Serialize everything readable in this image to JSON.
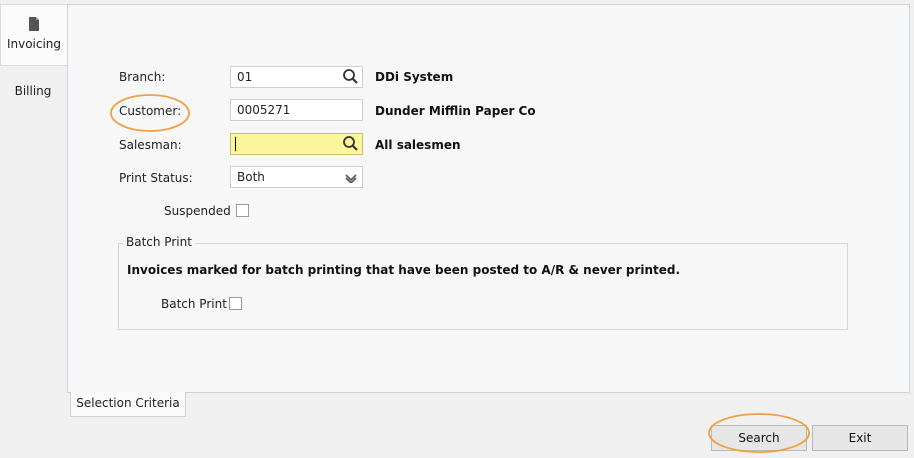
{
  "sidebar": {
    "tabs": [
      {
        "label": "Invoicing",
        "icon": "document-icon",
        "active": true
      },
      {
        "label": "Billing",
        "active": false
      }
    ]
  },
  "form": {
    "branch": {
      "label": "Branch:",
      "value": "01",
      "description": "DDi System"
    },
    "customer": {
      "label": "Customer:",
      "value": "0005271",
      "description": "Dunder Mifflin Paper Co"
    },
    "salesman": {
      "label": "Salesman:",
      "value": "",
      "description": "All salesmen"
    },
    "print_status": {
      "label": "Print Status:",
      "value": "Both"
    },
    "suspended": {
      "label": "Suspended",
      "checked": false
    }
  },
  "batch_print": {
    "legend": "Batch Print",
    "description": "Invoices marked for batch printing that have been posted to A/R & never printed.",
    "checkbox_label": "Batch Print",
    "checked": false
  },
  "tabs": {
    "selection_criteria": "Selection Criteria"
  },
  "buttons": {
    "search": "Search",
    "exit": "Exit"
  },
  "colors": {
    "highlight": "#f0a040",
    "salesman_field": "#fcf69a",
    "panel_border": "#c8d8e6"
  }
}
